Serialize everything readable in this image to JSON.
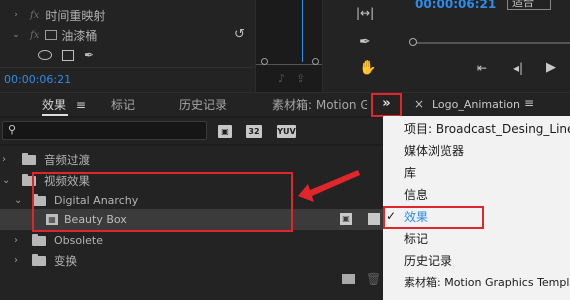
{
  "effect_controls": {
    "time_remap_label": "时间重映射",
    "opacity_mask_label": "油漆桶",
    "timecode": "00:00:06:21"
  },
  "monitor": {
    "timecode": "00:00:06:21",
    "fit_label": "适合"
  },
  "tabs": [
    {
      "label": "效果"
    },
    {
      "label": "标记"
    },
    {
      "label": "历史记录"
    },
    {
      "label": "素材箱: Motion G"
    }
  ],
  "panel_menu_icon": "hamburger-icon",
  "overflow_button": "»",
  "right_panel": {
    "close": "×",
    "title": "Logo_Animation"
  },
  "search": {
    "placeholder": ""
  },
  "badges": [
    "32",
    "YUV"
  ],
  "tree": [
    {
      "label": "音频过渡",
      "expanded": false
    },
    {
      "label": "视频效果",
      "expanded": true
    },
    {
      "label": "Digital Anarchy",
      "expanded": true
    },
    {
      "label": "Beauty Box",
      "selected": true
    },
    {
      "label": "Obsolete",
      "expanded": false
    },
    {
      "label": "变换",
      "expanded": false
    }
  ],
  "menu": {
    "items": [
      {
        "label": "项目: Broadcast_Desing_Lines_P"
      },
      {
        "label": "媒体浏览器"
      },
      {
        "label": "库"
      },
      {
        "label": "信息"
      },
      {
        "label": "效果",
        "checked": true
      },
      {
        "label": "标记"
      },
      {
        "label": "历史记录"
      },
      {
        "label": "素材箱: Motion Graphics Templa"
      }
    ]
  },
  "colors": {
    "accent_blue": "#2d8ceb",
    "highlight_red": "#e0262a",
    "panel_bg": "#232323",
    "menu_bg": "#f2f2f2"
  }
}
